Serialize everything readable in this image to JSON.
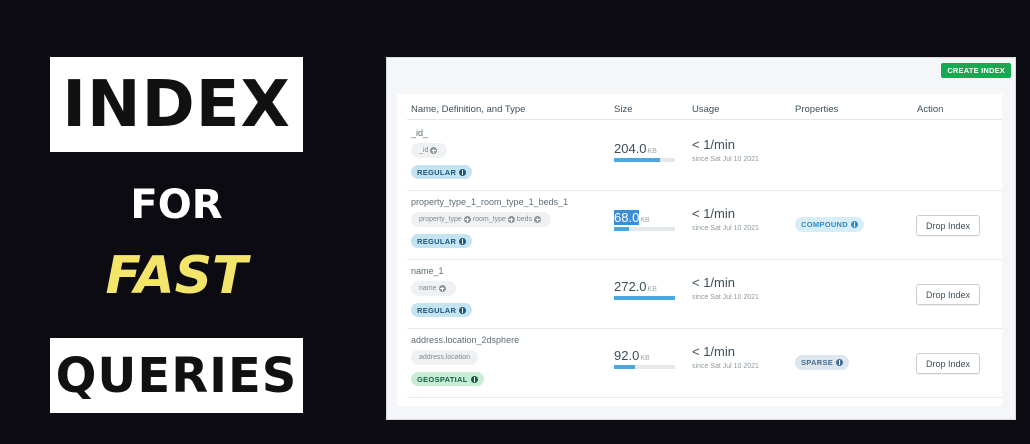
{
  "titles": {
    "line1": "INDEX",
    "line2": "FOR",
    "line3": "FAST",
    "line4": "QUERIES"
  },
  "colors": {
    "background": "#0c0b12",
    "fast_yellow": "#f3e56a",
    "create_green": "#13aa52",
    "bar_blue": "#4aa8e0"
  },
  "toolbar": {
    "create_index_label": "CREATE INDEX"
  },
  "table": {
    "headers": [
      "Name, Definition, and Type",
      "Size",
      "Usage",
      "Properties",
      "Action"
    ],
    "rows": [
      {
        "name": "_id_",
        "definition_fields": [
          "_id"
        ],
        "type": "REGULAR",
        "size_number": "204.0",
        "size_unit": "KB",
        "size_fraction": 0.75,
        "usage": "< 1/min",
        "usage_since": "since Sat Jul 10 2021",
        "property": "",
        "action": ""
      },
      {
        "name": "property_type_1_room_type_1_beds_1",
        "definition_fields": [
          "property_type",
          "room_type",
          "beds"
        ],
        "type": "REGULAR",
        "size_number": "68.0",
        "size_unit": "KB",
        "size_fraction": 0.25,
        "usage": "< 1/min",
        "usage_since": "since Sat Jul 10 2021",
        "property": "COMPOUND",
        "action": "Drop Index"
      },
      {
        "name": "name_1",
        "definition_fields": [
          "name"
        ],
        "type": "REGULAR",
        "size_number": "272.0",
        "size_unit": "KB",
        "size_fraction": 1.0,
        "usage": "< 1/min",
        "usage_since": "since Sat Jul 10 2021",
        "property": "",
        "action": "Drop Index"
      },
      {
        "name": "address.location_2dsphere",
        "definition_fields": [
          "address.location"
        ],
        "type": "GEOSPATIAL",
        "size_number": "92.0",
        "size_unit": "KB",
        "size_fraction": 0.34,
        "usage": "< 1/min",
        "usage_since": "since Sat Jul 10 2021",
        "property": "SPARSE",
        "action": "Drop Index"
      }
    ]
  }
}
